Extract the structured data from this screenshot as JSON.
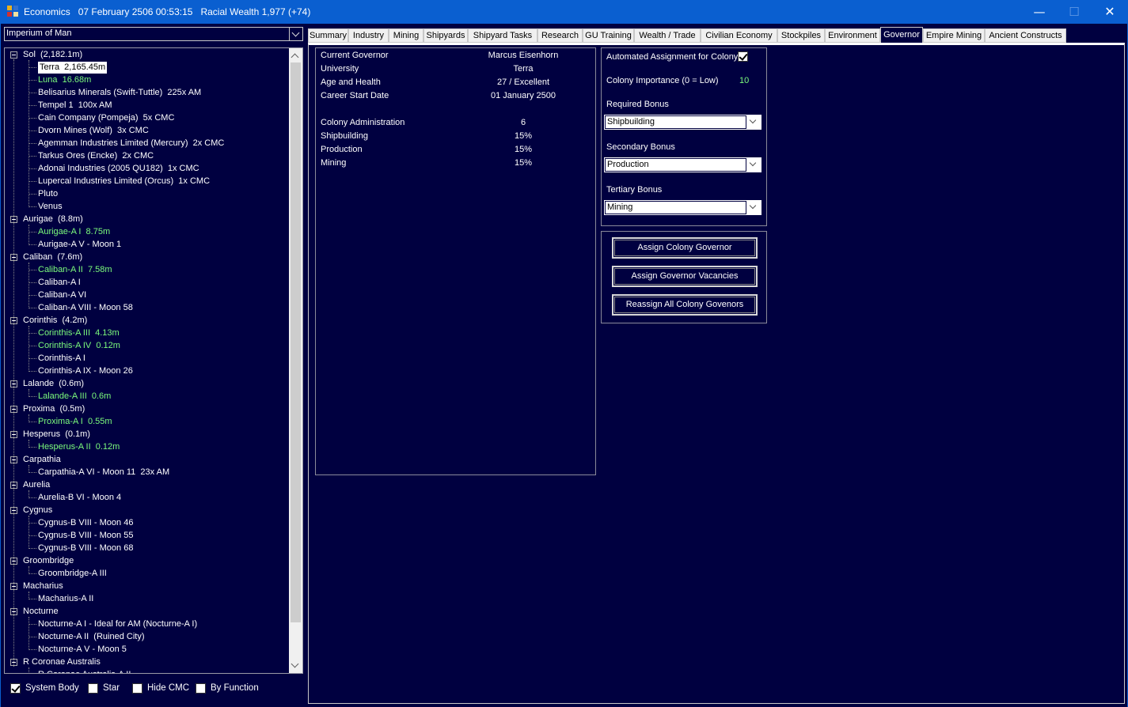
{
  "window": {
    "title": "Economics   07 February 2506 00:53:15   Racial Wealth 1,977 (+74)",
    "minimize_glyph": "—",
    "maximize_glyph": "☐",
    "close_glyph": "✕"
  },
  "race_selector": {
    "value": "Imperium of Man"
  },
  "tree": [
    {
      "label": "Sol  (2,182.1m)",
      "level": 0,
      "expanded": true
    },
    {
      "label": "Terra  2,165.45m",
      "level": 1,
      "selected": true
    },
    {
      "label": "Luna  16.68m",
      "level": 1,
      "green": true
    },
    {
      "label": "Belisarius Minerals (Swift-Tuttle)  225x AM",
      "level": 1
    },
    {
      "label": "Tempel 1  100x AM",
      "level": 1
    },
    {
      "label": "Cain Company (Pompeja)  5x CMC",
      "level": 1
    },
    {
      "label": "Dvorn Mines (Wolf)  3x CMC",
      "level": 1
    },
    {
      "label": "Agemman Industries Limited (Mercury)  2x CMC",
      "level": 1
    },
    {
      "label": "Tarkus Ores (Encke)  2x CMC",
      "level": 1
    },
    {
      "label": "Adonai Industries (2005 QU182)  1x CMC",
      "level": 1
    },
    {
      "label": "Lupercal Industries Limited (Orcus)  1x CMC",
      "level": 1
    },
    {
      "label": "Pluto",
      "level": 1
    },
    {
      "label": "Venus",
      "level": 1
    },
    {
      "label": "Aurigae  (8.8m)",
      "level": 0,
      "expanded": true
    },
    {
      "label": "Aurigae-A I  8.75m",
      "level": 1,
      "green": true
    },
    {
      "label": "Aurigae-A V - Moon 1",
      "level": 1
    },
    {
      "label": "Caliban  (7.6m)",
      "level": 0,
      "expanded": true
    },
    {
      "label": "Caliban-A II  7.58m",
      "level": 1,
      "green": true
    },
    {
      "label": "Caliban-A I",
      "level": 1
    },
    {
      "label": "Caliban-A VI",
      "level": 1
    },
    {
      "label": "Caliban-A VIII - Moon 58",
      "level": 1
    },
    {
      "label": "Corinthis  (4.2m)",
      "level": 0,
      "expanded": true
    },
    {
      "label": "Corinthis-A III  4.13m",
      "level": 1,
      "green": true
    },
    {
      "label": "Corinthis-A IV  0.12m",
      "level": 1,
      "green": true
    },
    {
      "label": "Corinthis-A I",
      "level": 1
    },
    {
      "label": "Corinthis-A IX - Moon 26",
      "level": 1
    },
    {
      "label": "Lalande  (0.6m)",
      "level": 0,
      "expanded": true
    },
    {
      "label": "Lalande-A III  0.6m",
      "level": 1,
      "green": true
    },
    {
      "label": "Proxima  (0.5m)",
      "level": 0,
      "expanded": true
    },
    {
      "label": "Proxima-A I  0.55m",
      "level": 1,
      "green": true
    },
    {
      "label": "Hesperus  (0.1m)",
      "level": 0,
      "expanded": true
    },
    {
      "label": "Hesperus-A II  0.12m",
      "level": 1,
      "green": true
    },
    {
      "label": "Carpathia",
      "level": 0,
      "expanded": true
    },
    {
      "label": "Carpathia-A VI - Moon 11  23x AM",
      "level": 1
    },
    {
      "label": "Aurelia",
      "level": 0,
      "expanded": true
    },
    {
      "label": "Aurelia-B VI - Moon 4",
      "level": 1
    },
    {
      "label": "Cygnus",
      "level": 0,
      "expanded": true
    },
    {
      "label": "Cygnus-B VIII - Moon 46",
      "level": 1
    },
    {
      "label": "Cygnus-B VIII - Moon 55",
      "level": 1
    },
    {
      "label": "Cygnus-B VIII - Moon 68",
      "level": 1
    },
    {
      "label": "Groombridge",
      "level": 0,
      "expanded": true
    },
    {
      "label": "Groombridge-A III",
      "level": 1
    },
    {
      "label": "Macharius",
      "level": 0,
      "expanded": true
    },
    {
      "label": "Macharius-A II",
      "level": 1
    },
    {
      "label": "Nocturne",
      "level": 0,
      "expanded": true
    },
    {
      "label": "Nocturne-A I - Ideal for AM (Nocturne-A I)",
      "level": 1
    },
    {
      "label": "Nocturne-A II  (Ruined City)",
      "level": 1
    },
    {
      "label": "Nocturne-A V - Moon 5",
      "level": 1
    },
    {
      "label": "R Coronae Australis",
      "level": 0,
      "expanded": true
    },
    {
      "label": "R Coronae Australis-A II",
      "level": 1
    }
  ],
  "filters": [
    {
      "label": "System Body",
      "checked": true
    },
    {
      "label": "Star",
      "checked": false
    },
    {
      "label": "Hide CMC",
      "checked": false
    },
    {
      "label": "By Function",
      "checked": false
    }
  ],
  "tabs": [
    {
      "label": "Summary"
    },
    {
      "label": "Industry"
    },
    {
      "label": "Mining"
    },
    {
      "label": "Shipyards"
    },
    {
      "label": "Shipyard Tasks"
    },
    {
      "label": "Research"
    },
    {
      "label": "GU Training"
    },
    {
      "label": "Wealth / Trade"
    },
    {
      "label": "Civilian Economy"
    },
    {
      "label": "Stockpiles"
    },
    {
      "label": "Environment"
    },
    {
      "label": "Governor",
      "active": true
    },
    {
      "label": "Empire Mining"
    },
    {
      "label": "Ancient Constructs"
    }
  ],
  "governor": {
    "rows": [
      {
        "label": "Current Governor",
        "value": "Marcus Eisenhorn"
      },
      {
        "label": "University",
        "value": "Terra"
      },
      {
        "label": "Age and Health",
        "value": "27 / Excellent"
      },
      {
        "label": "Career Start Date",
        "value": "01 January 2500"
      },
      {
        "label": "Colony Administration",
        "value": "6"
      },
      {
        "label": "Shipbuilding",
        "value": "15%"
      },
      {
        "label": "Production",
        "value": "15%"
      },
      {
        "label": "Mining",
        "value": "15%"
      }
    ]
  },
  "settings": {
    "automated_label": "Automated Assignment for Colony",
    "automated_checked": true,
    "importance_label": "Colony Importance (0 = Low)",
    "importance_value": "10",
    "required_label": "Required Bonus",
    "required_value": "Shipbuilding",
    "secondary_label": "Secondary Bonus",
    "secondary_value": "Production",
    "tertiary_label": "Tertiary Bonus",
    "tertiary_value": "Mining"
  },
  "actions": {
    "assign_colony_governor": "Assign Colony Governor",
    "assign_governor_vacancies": "Assign Governor Vacancies",
    "reassign_all": "Reassign All Colony Govenors"
  }
}
